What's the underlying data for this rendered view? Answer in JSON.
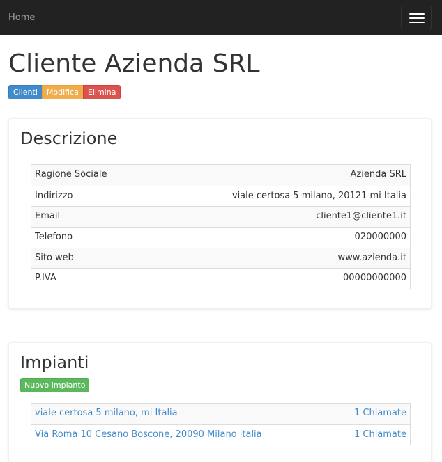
{
  "navbar": {
    "brand": "Home"
  },
  "page": {
    "title": "Cliente Azienda SRL"
  },
  "actions": {
    "clienti": "Clienti",
    "modifica": "Modifica",
    "elimina": "Elimina"
  },
  "descrizione": {
    "heading": "Descrizione",
    "rows": [
      {
        "label": "Ragione Sociale",
        "value": "Azienda SRL"
      },
      {
        "label": "Indirizzo",
        "value": "viale certosa 5 milano, 20121 mi Italia"
      },
      {
        "label": "Email",
        "value": "cliente1@cliente1.it"
      },
      {
        "label": "Telefono",
        "value": "020000000"
      },
      {
        "label": "Sito web",
        "value": "www.azienda.it"
      },
      {
        "label": "P.IVA",
        "value": "00000000000"
      }
    ]
  },
  "impianti": {
    "heading": "Impianti",
    "new_button": "Nuovo Impianto",
    "items": [
      {
        "address": "viale certosa 5 milano, mi Italia",
        "calls": "1 Chiamate"
      },
      {
        "address": "Via Roma 10 Cesano Boscone, 20090 Milano italia",
        "calls": "1 Chiamate"
      }
    ]
  },
  "colors": {
    "navbar": "#222222",
    "primary": "#428bca",
    "warning": "#f0ad4e",
    "danger": "#d9534f",
    "success": "#5cb85c",
    "link": "#428bca"
  }
}
